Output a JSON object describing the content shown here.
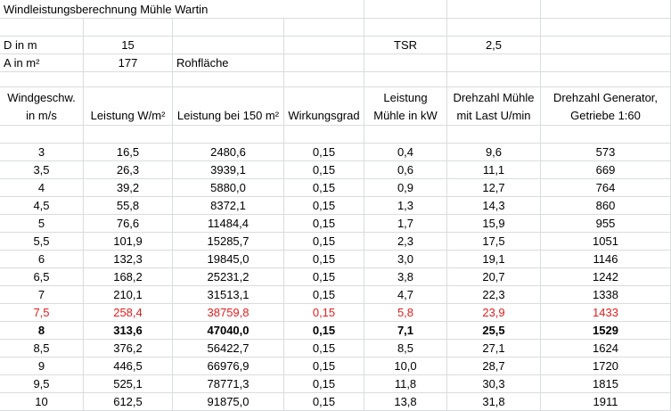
{
  "title": "Windleistungsberechnung Mühle Wartin",
  "params": [
    {
      "label": "D in m",
      "value": "15",
      "note": "",
      "key": "TSR",
      "key_value": "2,5"
    },
    {
      "label": "A in m²",
      "value": "177",
      "note": "Rohfläche",
      "key": "",
      "key_value": ""
    }
  ],
  "headers": [
    "Windgeschw. in m/s",
    "Leistung W/m²",
    "Leistung bei 150 m²",
    "Wirkungsgrad",
    "Leistung Mühle in kW",
    "Drehzahl Mühle mit Last  U/min",
    "Drehzahl Generator, Getriebe 1:60"
  ],
  "rows": [
    [
      "3",
      "16,5",
      "2480,6",
      "0,15",
      "0,4",
      "9,6",
      "573"
    ],
    [
      "3,5",
      "26,3",
      "3939,1",
      "0,15",
      "0,6",
      "11,1",
      "669"
    ],
    [
      "4",
      "39,2",
      "5880,0",
      "0,15",
      "0,9",
      "12,7",
      "764"
    ],
    [
      "4,5",
      "55,8",
      "8372,1",
      "0,15",
      "1,3",
      "14,3",
      "860"
    ],
    [
      "5",
      "76,6",
      "11484,4",
      "0,15",
      "1,7",
      "15,9",
      "955"
    ],
    [
      "5,5",
      "101,9",
      "15285,7",
      "0,15",
      "2,3",
      "17,5",
      "1051"
    ],
    [
      "6",
      "132,3",
      "19845,0",
      "0,15",
      "3,0",
      "19,1",
      "1146"
    ],
    [
      "6,5",
      "168,2",
      "25231,2",
      "0,15",
      "3,8",
      "20,7",
      "1242"
    ],
    [
      "7",
      "210,1",
      "31513,1",
      "0,15",
      "4,7",
      "22,3",
      "1338"
    ],
    [
      "7,5",
      "258,4",
      "38759,8",
      "0,15",
      "5,8",
      "23,9",
      "1433"
    ],
    [
      "8",
      "313,6",
      "47040,0",
      "0,15",
      "7,1",
      "25,5",
      "1529"
    ],
    [
      "8,5",
      "376,2",
      "56422,7",
      "0,15",
      "8,5",
      "27,1",
      "1624"
    ],
    [
      "9",
      "446,5",
      "66976,9",
      "0,15",
      "10,0",
      "28,7",
      "1720"
    ],
    [
      "9,5",
      "525,1",
      "78771,3",
      "0,15",
      "11,8",
      "30,3",
      "1815"
    ],
    [
      "10",
      "612,5",
      "91875,0",
      "0,15",
      "13,8",
      "31,8",
      "1911"
    ]
  ],
  "row_styles": [
    "",
    "",
    "",
    "",
    "",
    "",
    "",
    "",
    "",
    "red",
    "bold",
    "",
    "",
    "",
    ""
  ],
  "colors": {
    "gridline": "#dadcdd",
    "highlight_red": "#e21d1d"
  }
}
